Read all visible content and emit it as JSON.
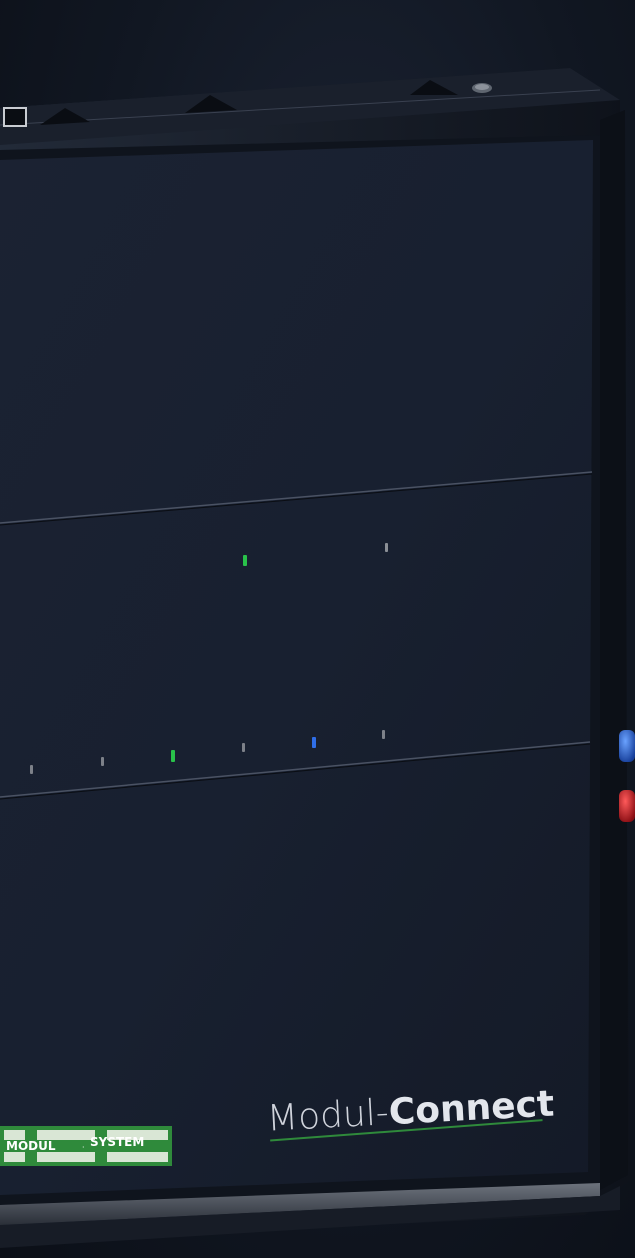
{
  "product": {
    "name_part1": "Modul-",
    "name_part2": "Connect"
  },
  "logo": {
    "text_left": "MODUL",
    "text_right": "SYSTEM",
    "color": "#2f8a3b"
  },
  "leds": {
    "colors": {
      "green": "#29c24a",
      "blue": "#2f6ee8",
      "off": "#8b8f96"
    }
  },
  "side_buttons": {
    "upper_color": "#2a66d8",
    "lower_color": "#c8202a"
  }
}
